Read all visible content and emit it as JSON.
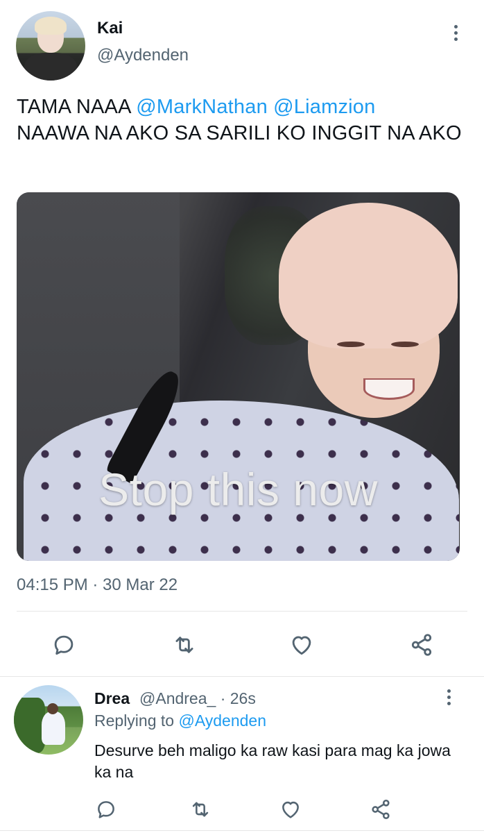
{
  "tweet": {
    "display_name": "Kai",
    "handle": "@Aydenden",
    "text_prefix": "TAMA NAAA ",
    "mention_1": "@MarkNathan",
    "mention_2": "@Liamzion",
    "text_suffix": "NAAWA NA AKO SA SARILI KO INGGIT NA AKO",
    "media_caption": "Stop this now",
    "timestamp": "04:15 PM · 30 Mar 22",
    "actions": [
      "reply",
      "retweet",
      "like",
      "share"
    ]
  },
  "reply": {
    "display_name": "Drea",
    "handle_time": "@Andrea_ · 26s",
    "replying_label": "Replying to ",
    "replying_handle": "@Aydenden",
    "text": "Desurve beh maligo ka raw kasi para mag ka jowa ka na"
  },
  "colors": {
    "accent": "#1d9bf0",
    "secondary_text": "#536471",
    "primary_text": "#0f1419"
  },
  "icons": [
    "more-icon",
    "reply-icon",
    "retweet-icon",
    "like-icon",
    "share-icon"
  ]
}
